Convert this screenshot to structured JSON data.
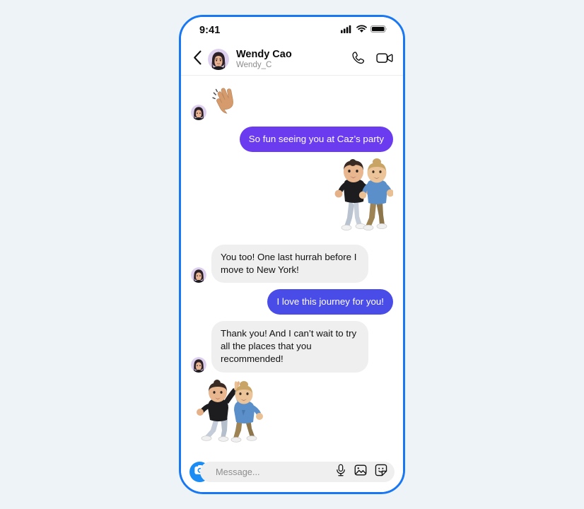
{
  "theme": {
    "frame_border": "#1877f2",
    "page_background": "#eef3f8",
    "sent_bubble_violet": "#6b3bf0",
    "sent_bubble_indigo": "#4a4ce8",
    "received_bubble": "#efefef",
    "camera_button": "#1b8cf3"
  },
  "status_bar": {
    "time": "9:41",
    "signal_icon": "cellular-signal-icon",
    "wifi_icon": "wifi-icon",
    "battery_icon": "battery-icon"
  },
  "header": {
    "back_icon": "chevron-left-icon",
    "avatar_icon": "avatar-wendy-cao",
    "title": "Wendy Cao",
    "subtitle": "Wendy_C",
    "call_icon": "phone-call-icon",
    "video_icon": "video-camera-icon"
  },
  "messages": [
    {
      "id": "m1",
      "direction": "incoming",
      "type": "sticker",
      "sticker": "waving-hand-sticker",
      "show_avatar": true
    },
    {
      "id": "m2",
      "direction": "outgoing",
      "type": "text",
      "text": "So fun seeing you at Caz’s party",
      "bubble_color": "violet"
    },
    {
      "id": "m3",
      "direction": "outgoing",
      "type": "sticker",
      "sticker": "avatars-dancing-sticker"
    },
    {
      "id": "m4",
      "direction": "incoming",
      "type": "text",
      "text": "You  too! One last hurrah before I move to New York!",
      "show_avatar": true
    },
    {
      "id": "m5",
      "direction": "outgoing",
      "type": "text",
      "text": "I love this journey for you!",
      "bubble_color": "indigo"
    },
    {
      "id": "m6",
      "direction": "incoming",
      "type": "text",
      "text": "Thank you! And I can’t wait to try all the places that you recommended!",
      "show_avatar": true
    },
    {
      "id": "m7",
      "direction": "incoming",
      "type": "sticker",
      "sticker": "avatars-high-five-sticker"
    }
  ],
  "composer": {
    "camera_icon": "camera-icon",
    "input_placeholder": "Message...",
    "input_value": "",
    "mic_icon": "microphone-icon",
    "gallery_icon": "photo-gallery-icon",
    "sticker_icon": "sticker-icon"
  }
}
